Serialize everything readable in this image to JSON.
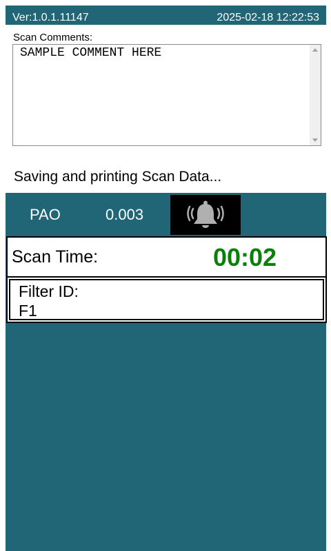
{
  "header": {
    "version": "Ver:1.0.1.11147",
    "datetime": "2025-02-18 12:22:53"
  },
  "comments": {
    "label": "Scan Comments:",
    "value": "SAMPLE COMMENT HERE"
  },
  "status": "Saving and printing Scan Data...",
  "reading": {
    "gas": "PAO",
    "value": "0.003"
  },
  "scan_time": {
    "label": "Scan Time:",
    "value": "00:02"
  },
  "filter": {
    "label": "Filter ID:",
    "value": "F1"
  },
  "icons": {
    "alarm": "ringing-bell-icon"
  },
  "colors": {
    "panel": "#206676",
    "scan_time": "#0a7f0a"
  }
}
